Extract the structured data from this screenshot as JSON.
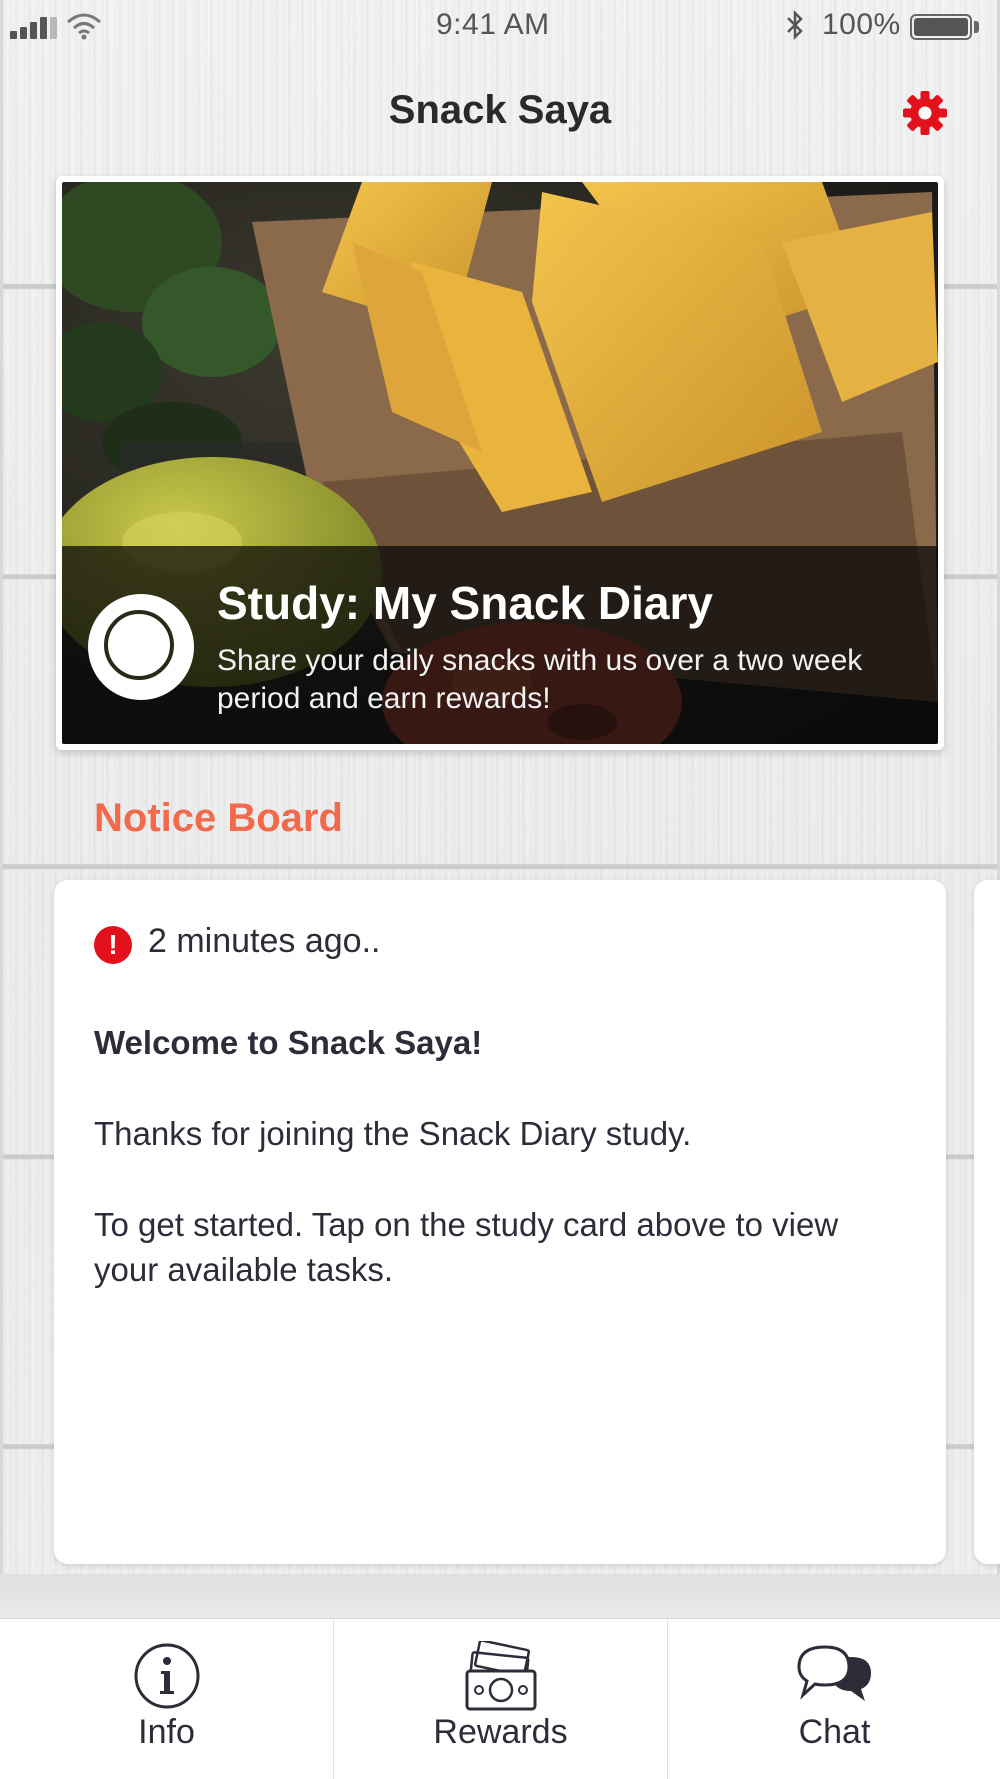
{
  "status_bar": {
    "time": "9:41 AM",
    "battery": "100%"
  },
  "header": {
    "title": "Snack Saya",
    "settings_icon": "gear-icon"
  },
  "study_card": {
    "title": "Study: My Snack Diary",
    "description": "Share your daily snacks with us over a two week period and earn rewards!"
  },
  "notice_board": {
    "title": "Notice Board",
    "notices": [
      {
        "time": "2 minutes ago..",
        "heading": "Welcome to Snack Saya!",
        "paragraphs": [
          "Thanks for joining the Snack Diary study.",
          "To get started. Tap on the study card above to view your available tasks."
        ]
      }
    ]
  },
  "tabs": [
    {
      "label": "Info",
      "icon": "info-icon"
    },
    {
      "label": "Rewards",
      "icon": "money-icon"
    },
    {
      "label": "Chat",
      "icon": "chat-bubbles-icon"
    }
  ],
  "colors": {
    "accent": "#f16a4c",
    "alert": "#e3111b",
    "gear": "#e3111b",
    "text": "#2d2d3a"
  }
}
